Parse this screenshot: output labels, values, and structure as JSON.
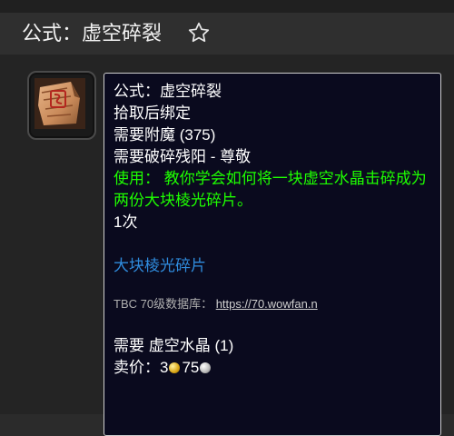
{
  "header": {
    "title": "公式：虚空碎裂",
    "favorite_icon": "star-outline-icon"
  },
  "item": {
    "icon": "recipe-scroll-icon",
    "name": "公式：虚空碎裂",
    "bind": "拾取后绑定",
    "requires_skill": "需要附魔 (375)",
    "requires_rep": "需要破碎残阳 - 尊敬",
    "use_label": "使用：",
    "use_text": "教你学会如何将一块虚空水晶击碎成为两份大块棱光碎片。",
    "charges": "1次",
    "created_item": "大块棱光碎片",
    "db_label": "TBC 70级数据库：",
    "db_url": "https://70.wowfan.n",
    "reagent_label": "需要",
    "reagent": "虚空水晶 (1)",
    "price_label": "卖价：",
    "price_gold": "3",
    "price_silver": "75"
  },
  "colors": {
    "tooltip_bg": "#0a0a1e",
    "use_green": "#1eff00",
    "link_blue": "#2f8bdc"
  }
}
